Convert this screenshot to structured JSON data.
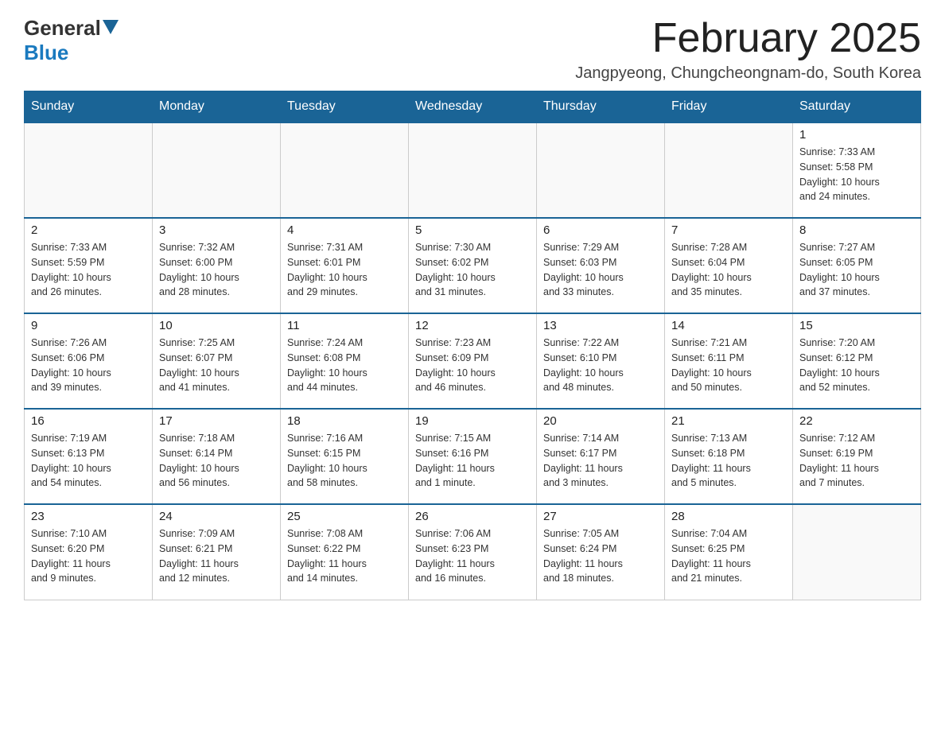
{
  "logo": {
    "general": "General",
    "blue": "Blue"
  },
  "title": "February 2025",
  "subtitle": "Jangpyeong, Chungcheongnam-do, South Korea",
  "days_of_week": [
    "Sunday",
    "Monday",
    "Tuesday",
    "Wednesday",
    "Thursday",
    "Friday",
    "Saturday"
  ],
  "weeks": [
    [
      {
        "day": "",
        "info": ""
      },
      {
        "day": "",
        "info": ""
      },
      {
        "day": "",
        "info": ""
      },
      {
        "day": "",
        "info": ""
      },
      {
        "day": "",
        "info": ""
      },
      {
        "day": "",
        "info": ""
      },
      {
        "day": "1",
        "info": "Sunrise: 7:33 AM\nSunset: 5:58 PM\nDaylight: 10 hours\nand 24 minutes."
      }
    ],
    [
      {
        "day": "2",
        "info": "Sunrise: 7:33 AM\nSunset: 5:59 PM\nDaylight: 10 hours\nand 26 minutes."
      },
      {
        "day": "3",
        "info": "Sunrise: 7:32 AM\nSunset: 6:00 PM\nDaylight: 10 hours\nand 28 minutes."
      },
      {
        "day": "4",
        "info": "Sunrise: 7:31 AM\nSunset: 6:01 PM\nDaylight: 10 hours\nand 29 minutes."
      },
      {
        "day": "5",
        "info": "Sunrise: 7:30 AM\nSunset: 6:02 PM\nDaylight: 10 hours\nand 31 minutes."
      },
      {
        "day": "6",
        "info": "Sunrise: 7:29 AM\nSunset: 6:03 PM\nDaylight: 10 hours\nand 33 minutes."
      },
      {
        "day": "7",
        "info": "Sunrise: 7:28 AM\nSunset: 6:04 PM\nDaylight: 10 hours\nand 35 minutes."
      },
      {
        "day": "8",
        "info": "Sunrise: 7:27 AM\nSunset: 6:05 PM\nDaylight: 10 hours\nand 37 minutes."
      }
    ],
    [
      {
        "day": "9",
        "info": "Sunrise: 7:26 AM\nSunset: 6:06 PM\nDaylight: 10 hours\nand 39 minutes."
      },
      {
        "day": "10",
        "info": "Sunrise: 7:25 AM\nSunset: 6:07 PM\nDaylight: 10 hours\nand 41 minutes."
      },
      {
        "day": "11",
        "info": "Sunrise: 7:24 AM\nSunset: 6:08 PM\nDaylight: 10 hours\nand 44 minutes."
      },
      {
        "day": "12",
        "info": "Sunrise: 7:23 AM\nSunset: 6:09 PM\nDaylight: 10 hours\nand 46 minutes."
      },
      {
        "day": "13",
        "info": "Sunrise: 7:22 AM\nSunset: 6:10 PM\nDaylight: 10 hours\nand 48 minutes."
      },
      {
        "day": "14",
        "info": "Sunrise: 7:21 AM\nSunset: 6:11 PM\nDaylight: 10 hours\nand 50 minutes."
      },
      {
        "day": "15",
        "info": "Sunrise: 7:20 AM\nSunset: 6:12 PM\nDaylight: 10 hours\nand 52 minutes."
      }
    ],
    [
      {
        "day": "16",
        "info": "Sunrise: 7:19 AM\nSunset: 6:13 PM\nDaylight: 10 hours\nand 54 minutes."
      },
      {
        "day": "17",
        "info": "Sunrise: 7:18 AM\nSunset: 6:14 PM\nDaylight: 10 hours\nand 56 minutes."
      },
      {
        "day": "18",
        "info": "Sunrise: 7:16 AM\nSunset: 6:15 PM\nDaylight: 10 hours\nand 58 minutes."
      },
      {
        "day": "19",
        "info": "Sunrise: 7:15 AM\nSunset: 6:16 PM\nDaylight: 11 hours\nand 1 minute."
      },
      {
        "day": "20",
        "info": "Sunrise: 7:14 AM\nSunset: 6:17 PM\nDaylight: 11 hours\nand 3 minutes."
      },
      {
        "day": "21",
        "info": "Sunrise: 7:13 AM\nSunset: 6:18 PM\nDaylight: 11 hours\nand 5 minutes."
      },
      {
        "day": "22",
        "info": "Sunrise: 7:12 AM\nSunset: 6:19 PM\nDaylight: 11 hours\nand 7 minutes."
      }
    ],
    [
      {
        "day": "23",
        "info": "Sunrise: 7:10 AM\nSunset: 6:20 PM\nDaylight: 11 hours\nand 9 minutes."
      },
      {
        "day": "24",
        "info": "Sunrise: 7:09 AM\nSunset: 6:21 PM\nDaylight: 11 hours\nand 12 minutes."
      },
      {
        "day": "25",
        "info": "Sunrise: 7:08 AM\nSunset: 6:22 PM\nDaylight: 11 hours\nand 14 minutes."
      },
      {
        "day": "26",
        "info": "Sunrise: 7:06 AM\nSunset: 6:23 PM\nDaylight: 11 hours\nand 16 minutes."
      },
      {
        "day": "27",
        "info": "Sunrise: 7:05 AM\nSunset: 6:24 PM\nDaylight: 11 hours\nand 18 minutes."
      },
      {
        "day": "28",
        "info": "Sunrise: 7:04 AM\nSunset: 6:25 PM\nDaylight: 11 hours\nand 21 minutes."
      },
      {
        "day": "",
        "info": ""
      }
    ]
  ]
}
